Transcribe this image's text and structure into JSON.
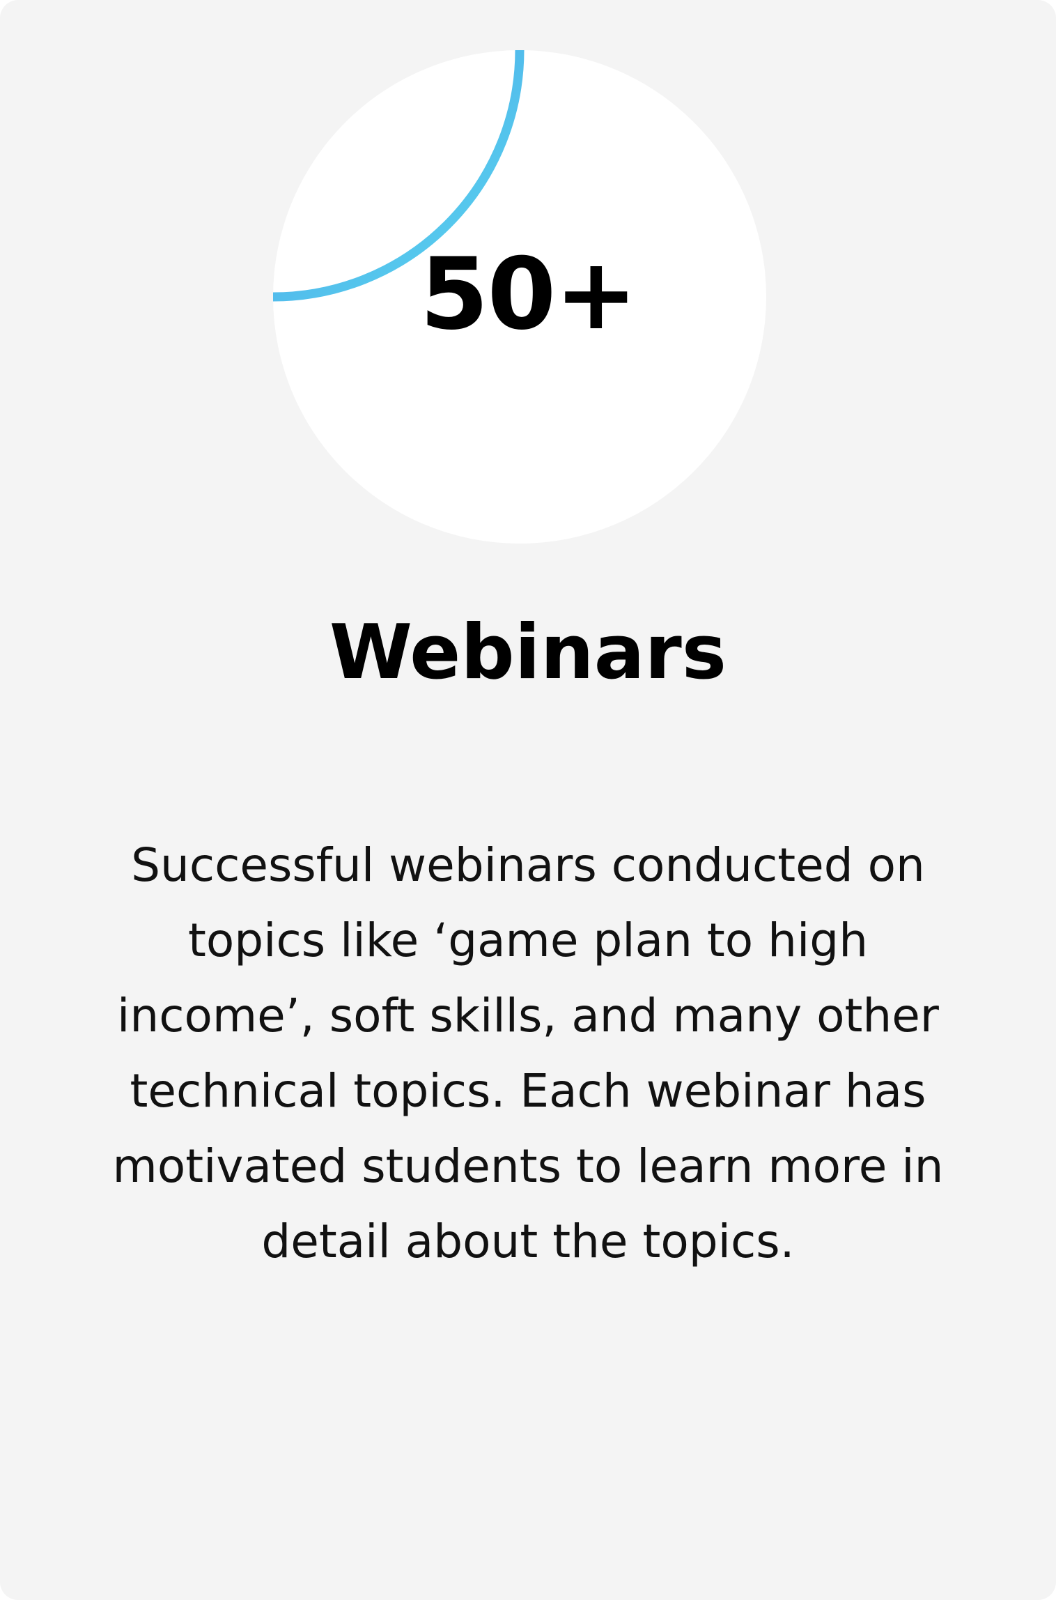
{
  "stat": {
    "value": "50+",
    "title": "Webinars",
    "description": "Successful webinars conducted on topics like ‘game plan to high income’, soft skills, and many other technical topics. Each webinar has motivated students to learn more in detail about the topics.",
    "progress_fraction": 0.25
  },
  "colors": {
    "card_background": "#f4f4f4",
    "circle_fill": "#ffffff",
    "arc_start": "#4aa3ea",
    "arc_end": "#5ad6ee",
    "text": "#000000"
  },
  "icons": {
    "progress": "progress-ring-icon"
  }
}
